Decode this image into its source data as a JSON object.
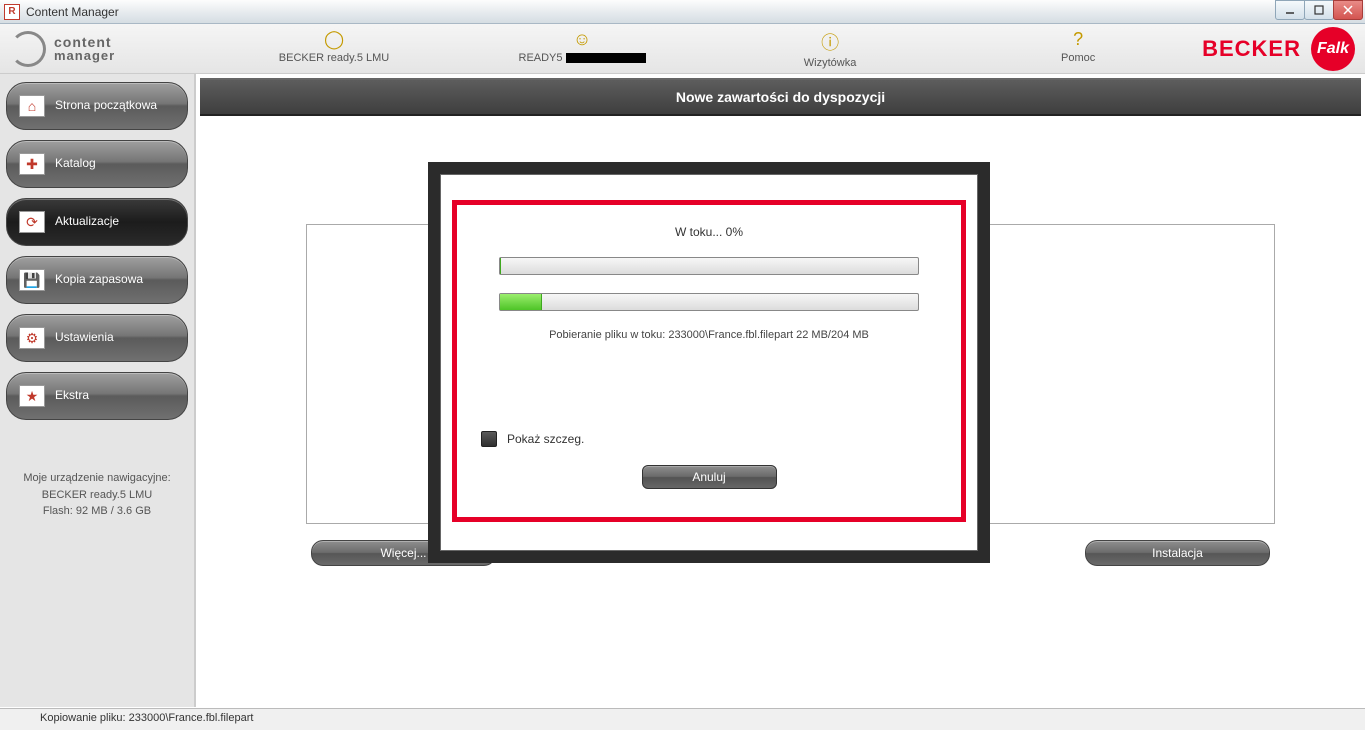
{
  "window": {
    "title": "Content Manager"
  },
  "app_logo": {
    "line1": "content",
    "line2": "manager"
  },
  "topnav": {
    "device": "BECKER ready.5 LMU",
    "ready5": "READY5",
    "wizytowka": "Wizytówka",
    "pomoc": "Pomoc"
  },
  "brand": {
    "becker": "BECKER",
    "falk": "Falk"
  },
  "sidebar": {
    "home": "Strona początkowa",
    "katalog": "Katalog",
    "aktualizacje": "Aktualizacje",
    "kopia": "Kopia zapasowa",
    "ustawienia": "Ustawienia",
    "ekstra": "Ekstra"
  },
  "device_info": {
    "line1": "Moje urządzenie nawigacyjne:",
    "line2": "BECKER ready.5 LMU",
    "line3": "Flash: 92 MB / 3.6 GB"
  },
  "main": {
    "header": "Nowe zawartości do dyspozycji",
    "more_btn": "Więcej...",
    "install_btn": "Instalacja"
  },
  "modal": {
    "progress_label": "W toku...  0%",
    "progress1_pct": "0%",
    "progress2_pct": "10%",
    "download_text": "Pobieranie pliku w toku:  233000\\France.fbl.filepart 22 MB/204 MB",
    "show_details": "Pokaż szczeg.",
    "cancel": "Anuluj"
  },
  "status": {
    "text": "Kopiowanie pliku:  233000\\France.fbl.filepart"
  }
}
